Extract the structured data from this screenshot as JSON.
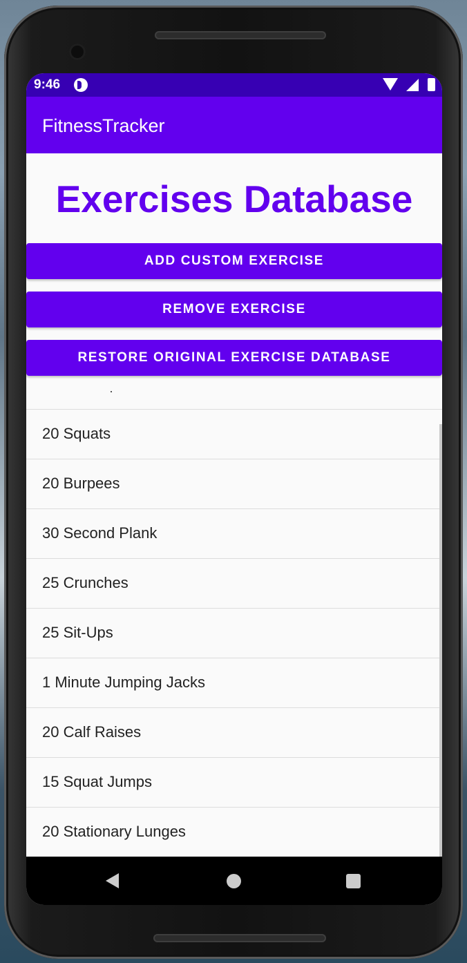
{
  "status_bar": {
    "time": "9:46"
  },
  "app_bar": {
    "title": "FitnessTracker"
  },
  "page": {
    "heading": "Exercises Database"
  },
  "buttons": {
    "add": "ADD CUSTOM EXERCISE",
    "remove": "REMOVE EXERCISE",
    "restore": "RESTORE ORIGINAL EXERCISE DATABASE"
  },
  "exercises": [
    "20 Squats",
    "20 Burpees",
    "30 Second Plank",
    "25 Crunches",
    "25 Sit-Ups",
    "1 Minute Jumping Jacks",
    "20 Calf Raises",
    "15 Squat Jumps",
    "20 Stationary Lunges"
  ],
  "colors": {
    "primary": "#6200ee",
    "status_bar": "#3700b3"
  },
  "icons": {
    "status": [
      "app-notification-icon",
      "wifi-icon",
      "signal-icon",
      "battery-icon"
    ],
    "nav": [
      "back-icon",
      "home-icon",
      "recents-icon"
    ]
  }
}
